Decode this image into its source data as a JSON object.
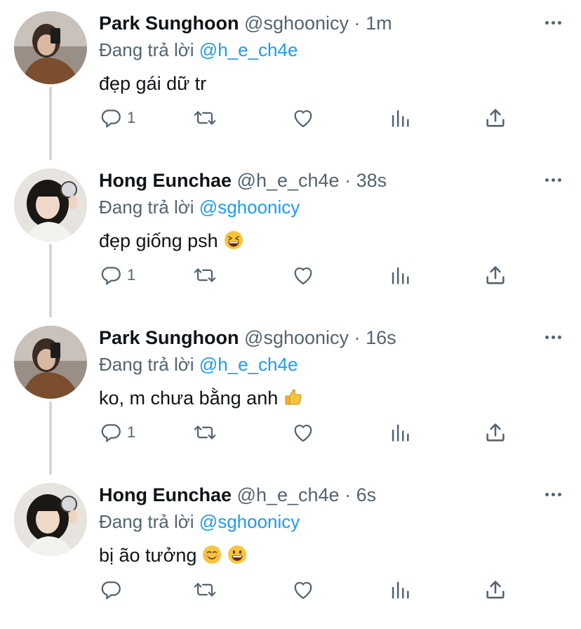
{
  "tweets": [
    {
      "name": "Park Sunghoon",
      "handle": "@sghoonicy",
      "separator": "·",
      "time": "1m",
      "replying_prefix": "Đang trả lời",
      "replying_to": "@h_e_ch4e",
      "text": "đẹp gái dữ tr",
      "emojis": [],
      "reply_count": "1"
    },
    {
      "name": "Hong Eunchae",
      "handle": "@h_e_ch4e",
      "separator": "·",
      "time": "38s",
      "replying_prefix": "Đang trả lời",
      "replying_to": "@sghoonicy",
      "text": "đẹp giống psh",
      "emojis": [
        "grinning-squinting-face"
      ],
      "reply_count": "1"
    },
    {
      "name": "Park Sunghoon",
      "handle": "@sghoonicy",
      "separator": "·",
      "time": "16s",
      "replying_prefix": "Đang trả lời",
      "replying_to": "@h_e_ch4e",
      "text": "ko, m chưa bằng anh",
      "emojis": [
        "thumbs-up"
      ],
      "reply_count": "1"
    },
    {
      "name": "Hong Eunchae",
      "handle": "@h_e_ch4e",
      "separator": "·",
      "time": "6s",
      "replying_prefix": "Đang trả lời",
      "replying_to": "@sghoonicy",
      "text": "bị ão tưởng",
      "emojis": [
        "smiling-face",
        "grinning-face"
      ],
      "reply_count": ""
    }
  ],
  "icons": {
    "reply": "reply-icon",
    "retweet": "retweet-icon",
    "like": "like-icon",
    "views": "views-icon",
    "share": "share-icon",
    "more": "more-icon"
  },
  "colors": {
    "name": "#0f1419",
    "muted": "#536471",
    "mention": "#1d9bf0",
    "thread_line": "#cfd9de"
  }
}
